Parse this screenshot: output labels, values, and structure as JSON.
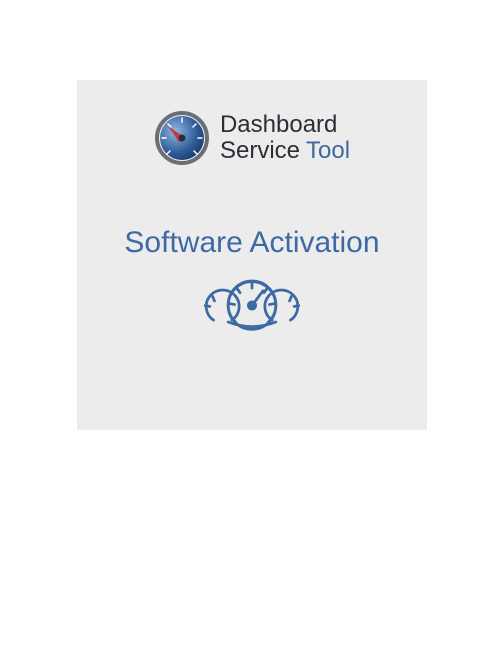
{
  "brand": {
    "line1": "Dashboard",
    "line2_word1": "Service",
    "line2_word2": "Tool"
  },
  "title": "Software Activation",
  "colors": {
    "accent": "#3d6aa3",
    "card_bg": "#ececec",
    "text_dark": "#2a2f36"
  }
}
